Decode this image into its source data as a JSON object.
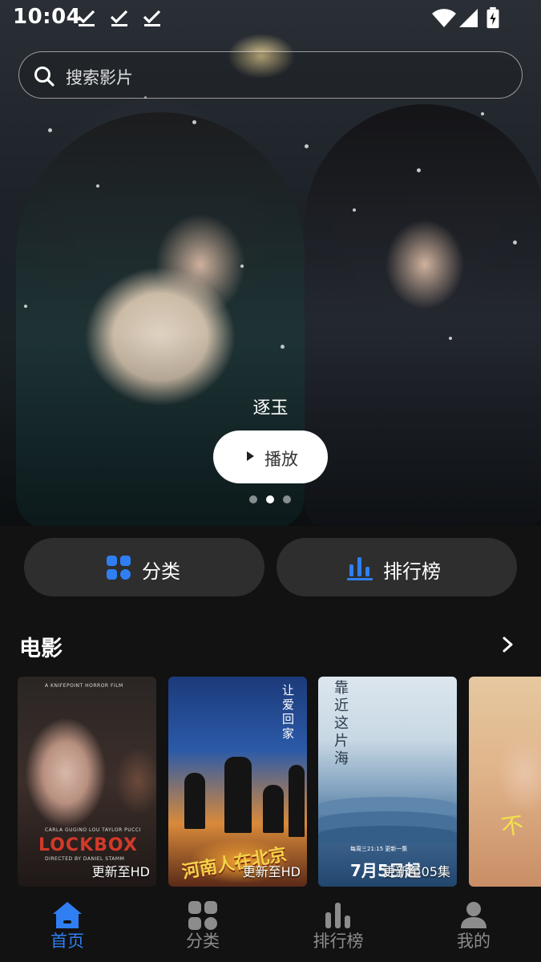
{
  "status_bar": {
    "time": "10:04",
    "notification_icons": [
      "check-icon",
      "check-icon",
      "check-icon"
    ],
    "system_icons": [
      "wifi-icon",
      "signal-icon",
      "battery-charging-icon"
    ]
  },
  "search": {
    "placeholder": "搜索影片",
    "icon": "search-icon"
  },
  "banner": {
    "title": "逐玉",
    "play_label": "播放",
    "pagination": {
      "count": 3,
      "active_index": 1
    }
  },
  "quick_actions": [
    {
      "label": "分类",
      "icon": "category-grid-icon"
    },
    {
      "label": "排行榜",
      "icon": "bar-chart-icon"
    }
  ],
  "colors": {
    "accent": "#2F7FF2",
    "background": "#121212",
    "button_bg": "#2E2E2E",
    "nav_inactive": "#8C8C8C"
  },
  "section": {
    "title": "电影",
    "more_icon": "chevron-right-icon",
    "items": [
      {
        "tag": "更新至HD",
        "poster_text": "LOCKBOX",
        "poster_small_top": "A KNIFEPOINT HORROR FILM",
        "poster_credits": "CARLA GUGINO    LOU TAYLOR PUCCI",
        "poster_director": "DIRECTED BY DANIEL STAMM"
      },
      {
        "tag": "更新至HD",
        "poster_text": "河南人在北京",
        "poster_vertical": "让爱回家"
      },
      {
        "tag": "更新至05集",
        "poster_text": "7月5日起",
        "poster_vertical": "靠近这片海",
        "poster_note": "每周三21:15 更新一集"
      },
      {
        "tag": "",
        "poster_text": "不"
      }
    ]
  },
  "bottom_nav": {
    "active_index": 0,
    "items": [
      {
        "label": "首页",
        "icon": "home-icon"
      },
      {
        "label": "分类",
        "icon": "category-grid-icon"
      },
      {
        "label": "排行榜",
        "icon": "bar-chart-icon"
      },
      {
        "label": "我的",
        "icon": "profile-icon"
      }
    ]
  }
}
